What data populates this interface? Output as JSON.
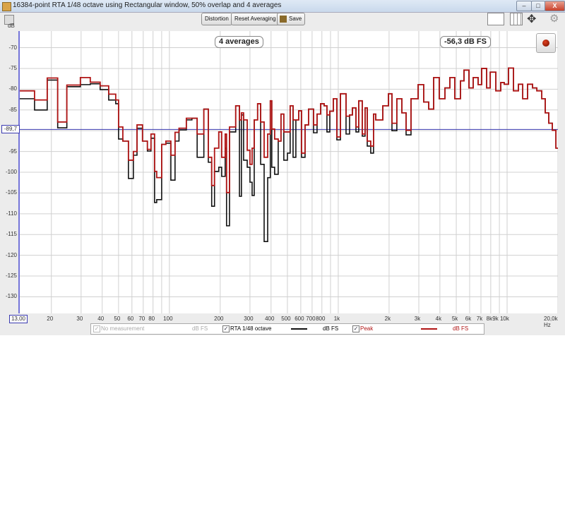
{
  "window": {
    "title": "16384-point RTA 1/48 octave using Rectangular window, 50% overlap and 4 averages",
    "minimize": "–",
    "maximize": "□",
    "close": "X"
  },
  "toolbar": {
    "distortion_label": "Distortion",
    "reset_label": "Reset Averaging",
    "save_label": "Save",
    "icons": [
      "settings-icon",
      "scale-icon",
      "grid-icon",
      "pan-icon",
      "gear-icon"
    ]
  },
  "plot": {
    "y_unit": "dB",
    "averages_badge": "4 averages",
    "level_badge": "-56,3 dB FS",
    "cursor_level_label": "-89,7",
    "cursor_level_value": -89.7,
    "x_start_label": "13,00",
    "colors": {
      "rta": "#111111",
      "peak": "#b01515",
      "cursor": "#3a3ab0"
    }
  },
  "legend": [
    {
      "label": "No measurement",
      "unit": "dB FS",
      "checked": true,
      "disabled": true
    },
    {
      "label": "RTA 1/48 octave",
      "unit": "dB FS",
      "checked": true,
      "color": "#111111"
    },
    {
      "label": "Peak",
      "unit": "dB FS",
      "checked": true,
      "color": "#b01515"
    }
  ],
  "chart_data": {
    "type": "line",
    "xscale": "log",
    "xlim": [
      13,
      20000
    ],
    "ylim": [
      -134,
      -66
    ],
    "y_ticks": [
      -70,
      -75,
      -80,
      -85,
      -90,
      -95,
      -100,
      -105,
      -110,
      -115,
      -120,
      -125,
      -130
    ],
    "y_tick_labels": [
      "-70",
      "-75",
      "-80",
      "-85",
      "-90",
      "-95",
      "-100",
      "-105",
      "-110",
      "-115",
      "-120",
      "-125",
      "-130"
    ],
    "x_ticks": [
      20,
      30,
      40,
      50,
      60,
      70,
      80,
      100,
      200,
      300,
      400,
      500,
      600,
      700,
      800,
      1000,
      2000,
      3000,
      4000,
      5000,
      6000,
      7000,
      8000,
      9000,
      10000,
      20000
    ],
    "x_tick_labels": [
      "20",
      "30",
      "40",
      "50",
      "60",
      "70",
      "80",
      "100",
      "200",
      "300",
      "400",
      "500",
      "600",
      "700",
      "800",
      "1k",
      "2k",
      "3k",
      "4k",
      "5k",
      "6k",
      "7k",
      "8k",
      "9k 10k",
      "",
      "20,0k Hz"
    ],
    "x_grid": [
      20,
      30,
      40,
      50,
      60,
      70,
      80,
      90,
      100,
      200,
      300,
      400,
      500,
      600,
      700,
      800,
      900,
      1000,
      2000,
      3000,
      4000,
      5000,
      6000,
      7000,
      8000,
      9000,
      10000,
      20000
    ],
    "x": [
      13,
      15.9,
      18.9,
      21.8,
      24.7,
      29.7,
      34,
      38.9,
      43.7,
      48.1,
      50,
      53,
      57.2,
      61.2,
      64.3,
      69.3,
      74.1,
      77.8,
      81.7,
      84.1,
      90,
      95.3,
      102,
      108,
      114,
      126,
      136,
      146,
      160,
      170,
      178,
      185,
      196,
      204,
      214,
      218,
      227,
      247,
      260,
      267,
      275,
      289,
      300,
      309,
      318,
      333,
      347,
      364,
      382,
      396,
      404,
      420,
      441,
      458,
      476,
      500,
      519,
      540,
      561,
      583,
      606,
      636,
      667,
      714,
      749,
      786,
      825,
      857,
      891,
      935,
      981,
      1030,
      1112,
      1167,
      1213,
      1273,
      1322,
      1387,
      1442,
      1485,
      1557,
      1618,
      1667,
      1836,
      1983,
      2080,
      2223,
      2381,
      2522,
      2697,
      2972,
      3206,
      3433,
      3673,
      3963,
      4285,
      4582,
      4900,
      5293,
      5556,
      5945,
      6299,
      6736,
      7068,
      7566,
      7943,
      8576,
      9170,
      9614,
      10190,
      10910,
      11670,
      12370,
      13220,
      14150,
      15000,
      16040,
      16820,
      17650,
      18530,
      19450,
      20000
    ],
    "series": [
      {
        "name": "RTA 1/48 octave",
        "values": [
          -82.3,
          -85,
          -77.8,
          -89.3,
          -79.4,
          -78.9,
          -78.7,
          -80.1,
          -82.6,
          -83.5,
          -92,
          -92.5,
          -101.5,
          -95.9,
          -89.4,
          -92.5,
          -94.9,
          -91.8,
          -107.3,
          -106.6,
          -93.3,
          -93,
          -101.9,
          -92.5,
          -89.8,
          -87.4,
          -87,
          -96.4,
          -84.8,
          -97.6,
          -108.2,
          -99.8,
          -98.8,
          -101,
          -94.2,
          -112.9,
          -90.3,
          -84,
          -105.8,
          -86.2,
          -97.1,
          -98.8,
          -102.4,
          -105.6,
          -87.4,
          -83.5,
          -98.1,
          -116.7,
          -101.3,
          -82.8,
          -98.8,
          -100.5,
          -92.5,
          -86,
          -97.1,
          -95.4,
          -84,
          -96.4,
          -87.4,
          -85.2,
          -96.4,
          -88.6,
          -84.8,
          -90.5,
          -86,
          -83.5,
          -84,
          -90.3,
          -85.3,
          -82.3,
          -92.2,
          -81.1,
          -90.8,
          -86.2,
          -84.5,
          -90.3,
          -82.8,
          -91.3,
          -84.5,
          -93.7,
          -95.4,
          -86,
          -87.4,
          -84,
          -81.1,
          -90,
          -82.3,
          -85.7,
          -91,
          -82.3,
          -78.9,
          -83.1,
          -84.8,
          -77.2,
          -82.3,
          -79.7,
          -77.2,
          -82.3,
          -78,
          -75.4,
          -79.7,
          -77.2,
          -78.9,
          -75,
          -79.7,
          -75.9,
          -80.4,
          -78.4,
          -78.8,
          -74.9,
          -80.4,
          -78.8,
          -82.3,
          -78.8,
          -79.7,
          -80.4,
          -82.3,
          -85.7,
          -88.2,
          -89.9,
          -94.2,
          -94.2
        ]
      },
      {
        "name": "Peak",
        "values": [
          -80.4,
          -82.6,
          -77.3,
          -87.9,
          -79,
          -77.2,
          -78.3,
          -79.2,
          -81.2,
          -82.6,
          -89.1,
          -92.5,
          -97.1,
          -95,
          -88.6,
          -92.5,
          -94.5,
          -90.8,
          -99.8,
          -101.3,
          -93.3,
          -92.5,
          -95.9,
          -90.4,
          -89.4,
          -87,
          -87,
          -90.8,
          -84.8,
          -96.4,
          -103.2,
          -94.2,
          -90.3,
          -96.4,
          -90.8,
          -104.9,
          -89.1,
          -84,
          -87.4,
          -85.7,
          -87.4,
          -94.7,
          -98.1,
          -94.2,
          -87.4,
          -83.5,
          -87.9,
          -96.4,
          -90.8,
          -82.8,
          -89.6,
          -92,
          -92.5,
          -86,
          -90.3,
          -90.3,
          -84,
          -87.4,
          -87.4,
          -85.2,
          -95.4,
          -88.6,
          -84.8,
          -88.6,
          -86,
          -83.5,
          -84,
          -86.2,
          -85.3,
          -82.3,
          -91.5,
          -81.1,
          -86.5,
          -86.2,
          -84.5,
          -89.1,
          -82.8,
          -90.8,
          -84.5,
          -92.5,
          -93.7,
          -86,
          -87.4,
          -84,
          -81.1,
          -88.2,
          -82.3,
          -85.7,
          -89.9,
          -82.3,
          -78.9,
          -83.1,
          -84.8,
          -77.2,
          -82.3,
          -79.7,
          -77.2,
          -82.3,
          -78,
          -75.4,
          -79.7,
          -77.2,
          -78.9,
          -75,
          -79.7,
          -75.9,
          -80.4,
          -78.4,
          -78.8,
          -74.9,
          -80.4,
          -78.8,
          -82.3,
          -78.8,
          -79.7,
          -80.4,
          -82.3,
          -85.7,
          -88.2,
          -89.9,
          -94.2,
          -94.2
        ]
      }
    ]
  }
}
